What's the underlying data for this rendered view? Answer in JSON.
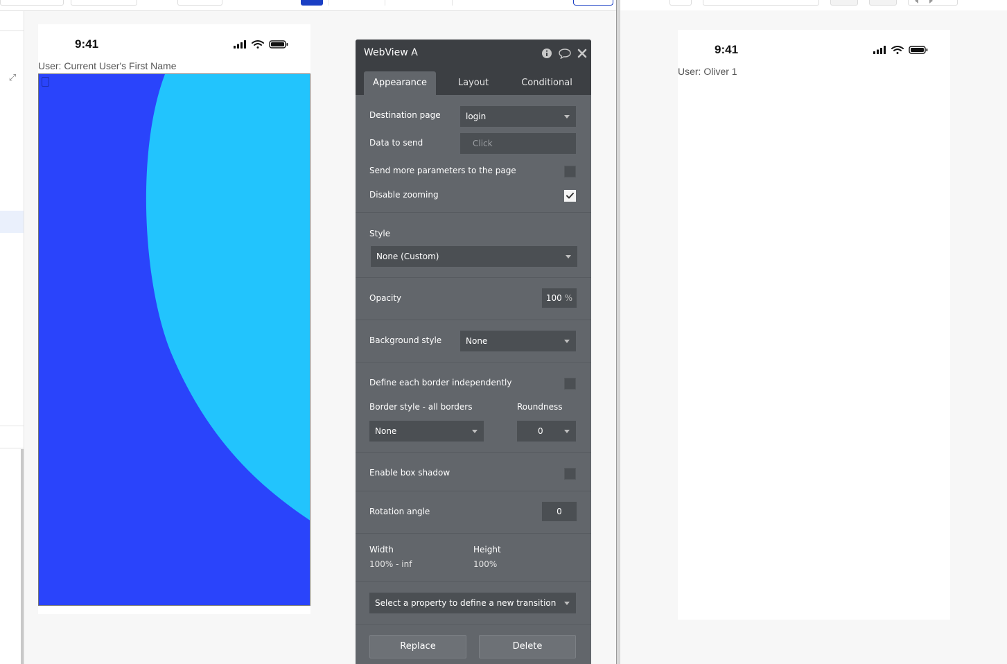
{
  "editor": {
    "phone": {
      "time": "9:41",
      "user_label": "User: Current User's First Name"
    },
    "webview_colors": {
      "primary": "#2a44fb",
      "secondary": "#22c4fd"
    },
    "icons": [
      "expand-icon",
      "signal-icon",
      "wifi-icon",
      "battery-icon"
    ]
  },
  "property_panel": {
    "title": "WebView A",
    "header_icons": [
      "info-icon",
      "comment-icon",
      "close-icon"
    ],
    "tabs": [
      {
        "label": "Appearance",
        "active": true
      },
      {
        "label": "Layout",
        "active": false
      },
      {
        "label": "Conditional",
        "active": false
      }
    ],
    "destination_page": {
      "label": "Destination page",
      "value": "login"
    },
    "data_to_send": {
      "label": "Data to send",
      "placeholder": "Click"
    },
    "send_more_params": {
      "label": "Send more parameters to the page",
      "checked": false
    },
    "disable_zooming": {
      "label": "Disable zooming",
      "checked": true
    },
    "style": {
      "label": "Style",
      "value": "None (Custom)"
    },
    "opacity": {
      "label": "Opacity",
      "value": "100",
      "unit": "%"
    },
    "background_style": {
      "label": "Background style",
      "value": "None"
    },
    "define_borders": {
      "label": "Define each border independently",
      "checked": false
    },
    "border_style": {
      "label": "Border style - all borders",
      "value": "None"
    },
    "roundness": {
      "label": "Roundness",
      "value": "0"
    },
    "box_shadow": {
      "label": "Enable box shadow",
      "checked": false
    },
    "rotation": {
      "label": "Rotation angle",
      "value": "0"
    },
    "width": {
      "label": "Width",
      "value": "100% - inf"
    },
    "height": {
      "label": "Height",
      "value": "100%"
    },
    "transition": {
      "placeholder": "Select a property to define a new transition"
    },
    "buttons": {
      "replace": "Replace",
      "delete": "Delete"
    }
  },
  "preview": {
    "time": "9:41",
    "user_label": "User: Oliver 1"
  }
}
